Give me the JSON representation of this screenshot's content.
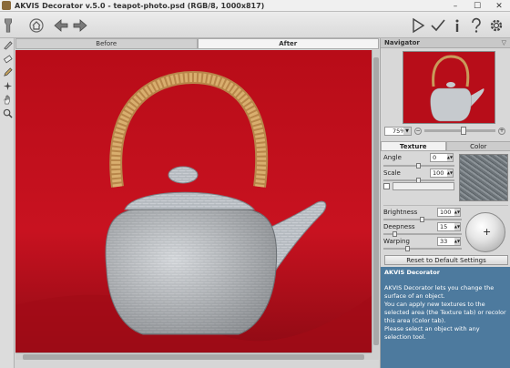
{
  "window": {
    "title": "AKVIS Decorator v.5.0 - teapot-photo.psd (RGB/8, 1000x817)",
    "minimize": "–",
    "maximize": "☐",
    "close": "✕"
  },
  "toolbar": {
    "left_icons": [
      "home-icon",
      "back-arrow-icon",
      "forward-arrow-icon"
    ],
    "right_icons": [
      "run-icon",
      "apply-icon",
      "info-icon",
      "help-icon",
      "settings-icon"
    ]
  },
  "tools": [
    "selection-brush-icon",
    "eraser-icon",
    "pencil-icon",
    "magic-tool-icon",
    "hand-icon",
    "zoom-icon"
  ],
  "view_tabs": {
    "before": "Before",
    "after": "After"
  },
  "navigator": {
    "title": "Navigator",
    "zoom": "75%"
  },
  "panel_tabs": {
    "texture": "Texture",
    "color": "Color"
  },
  "params": {
    "angle_label": "Angle",
    "angle_value": "0",
    "scale_label": "Scale",
    "scale_value": "100",
    "brightness_label": "Brightness",
    "brightness_value": "100",
    "deepness_label": "Deepness",
    "deepness_value": "15",
    "warping_label": "Warping",
    "warping_value": "33"
  },
  "reset_label": "Reset to Default Settings",
  "help": {
    "title": "AKVIS Decorator",
    "line1": "AKVIS Decorator lets you change the surface of an object.",
    "line2": "You can apply new textures to the selected area (the Texture tab) or recolor this area (Color tab).",
    "line3": "Please select an object with any selection tool."
  }
}
